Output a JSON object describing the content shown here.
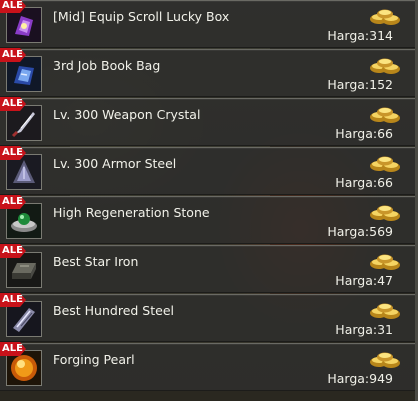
{
  "shop": {
    "badge_label": "ALE",
    "items": [
      {
        "name": "[Mid] Equip Scroll Lucky Box",
        "price": "Harga:314",
        "icon": "purple-scroll-box-icon"
      },
      {
        "name": "3rd Job Book Bag",
        "price": "Harga:152",
        "icon": "blue-book-bag-icon"
      },
      {
        "name": "Lv. 300 Weapon Crystal",
        "price": "Harga:66",
        "icon": "weapon-crystal-icon"
      },
      {
        "name": "Lv. 300 Armor Steel",
        "price": "Harga:66",
        "icon": "armor-steel-icon"
      },
      {
        "name": "High Regeneration Stone",
        "price": "Harga:569",
        "icon": "regeneration-stone-icon"
      },
      {
        "name": "Best Star Iron",
        "price": "Harga:47",
        "icon": "star-iron-icon"
      },
      {
        "name": "Best Hundred Steel",
        "price": "Harga:31",
        "icon": "hundred-steel-icon"
      },
      {
        "name": "Forging Pearl",
        "price": "Harga:949",
        "icon": "forging-pearl-icon"
      }
    ],
    "currency_icon": "gold-ingot-icon"
  },
  "colors": {
    "sale_badge": "#c8121a",
    "row_bg": "#303030",
    "text": "#f2f2ea",
    "gold": "#e8c040"
  }
}
